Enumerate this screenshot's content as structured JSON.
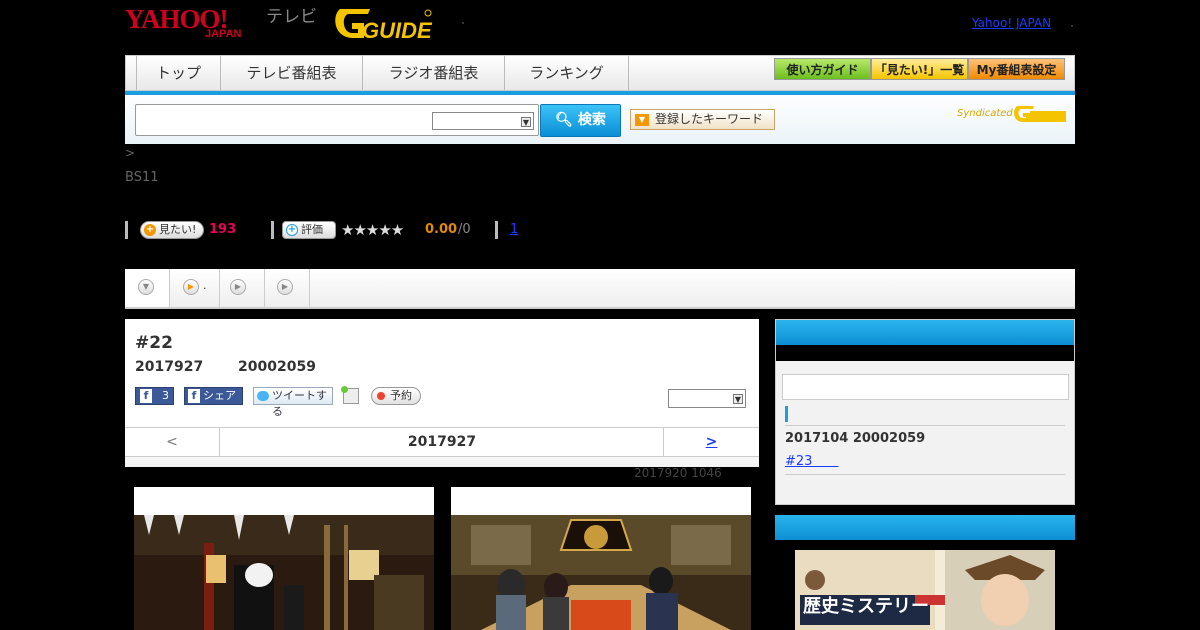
{
  "header": {
    "yahoo_logo": "YAHOO!",
    "yahoo_logo_sub": "JAPAN",
    "tv_label": "テレビ",
    "gguide_logo": "GUIDE",
    "yahoo_japan_link": "Yahoo! JAPAN"
  },
  "nav": {
    "tabs": [
      "トップ",
      "テレビ番組表",
      "ラジオ番組表",
      "ランキング"
    ],
    "buttons": [
      "使い方ガイド",
      "「見たい!」一覧",
      "My番組表設定"
    ]
  },
  "search": {
    "button_label": "検索",
    "keyword_button": "登録したキーワード",
    "syndicated_label": "Syndicated"
  },
  "breadcrumb": ">",
  "channel": "BS11",
  "stats": {
    "want_label": "見たい!",
    "want_count": "193",
    "rate_label": "評価",
    "stars": "★★★★★",
    "score": "0.00",
    "score_count": "/0",
    "link": "1"
  },
  "tabs": {
    "second_suffix": "."
  },
  "program": {
    "title": "#22",
    "date": "2017927",
    "time": "20002059",
    "fb_like_count": "3",
    "fb_share_label": "シェア",
    "tweet_label": "ツイートする",
    "reserve_label": "予約",
    "pager_prev": "<",
    "pager_current": "2017927",
    "pager_next": ">",
    "updated": "2017920  1046"
  },
  "sidebar": {
    "next_date": "2017104  20002059",
    "next_ep": "#23　　"
  },
  "banner": {
    "title": "歴史ミステリー"
  },
  "colors": {
    "accent": "#1a9ee0",
    "want_count": "#e8005a",
    "score": "#e08a00",
    "link": "#1a3cff"
  }
}
